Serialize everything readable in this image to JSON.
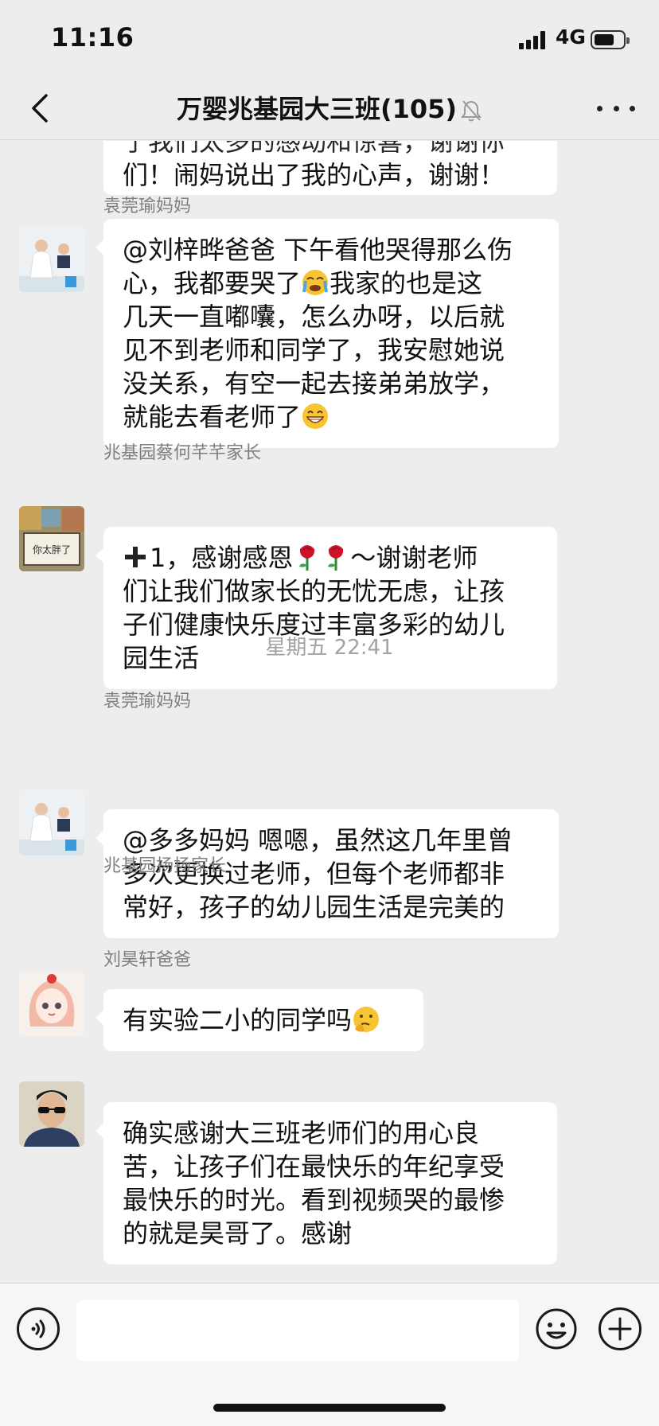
{
  "status_bar": {
    "time": "11:16",
    "network": "4G"
  },
  "nav": {
    "title": "万婴兆基园大三班(105)",
    "back_icon": "chevron-left-icon",
    "mute_icon": "bell-muted-icon",
    "more_icon": "more-dots-icon"
  },
  "messages": [
    {
      "sender": "",
      "lines": [
        "们！闹妈说出了我的心声，谢谢！"
      ],
      "partial_top_line": "了我们太多的感动和惊喜，谢谢你"
    },
    {
      "sender": "袁莞瑜妈妈",
      "lines": [
        "@刘梓晔爸爸 下午看他哭得那么伤",
        "心，我都要哭了",
        "我家的也是这",
        "几天一直嘟囔，怎么办呀，以后就",
        "见不到老师和同学了，我安慰她说",
        "没关系，有空一起去接弟弟放学，",
        "就能去看老师了"
      ]
    },
    {
      "sender": "兆基园蔡何芊芊家长",
      "lines": [
        "1，感谢感恩",
        "～谢谢老师",
        "们让我们做家长的无忧无虑，让孩",
        "子们健康快乐度过丰富多彩的幼儿",
        "园生活"
      ]
    },
    {
      "sender": "袁莞瑜妈妈",
      "lines": [
        "@多多妈妈 嗯嗯，虽然这几年里曾",
        "多次更换过老师，但每个老师都非",
        "常好，孩子的幼儿园生活是完美的"
      ]
    },
    {
      "sender": "兆基园扬扬家长",
      "lines": [
        "有实验二小的同学吗"
      ]
    },
    {
      "sender": "刘昊轩爸爸",
      "lines": [
        "确实感谢大三班老师们的用心良",
        "苦，让孩子们在最快乐的年纪享受",
        "最快乐的时光。看到视频哭的最惨",
        "的就是昊哥了。感谢"
      ]
    }
  ],
  "timestamp": "星期五 22:41",
  "avatar_sign_text": "你太胖了",
  "input_bar": {
    "voice_icon": "voice-icon",
    "emoji_icon": "emoji-icon",
    "add_icon": "plus-circle-icon"
  },
  "colors": {
    "background": "#ededed",
    "bubble": "#ffffff",
    "sender": "#7f7f7f",
    "timestamp": "#a2a2a2"
  }
}
